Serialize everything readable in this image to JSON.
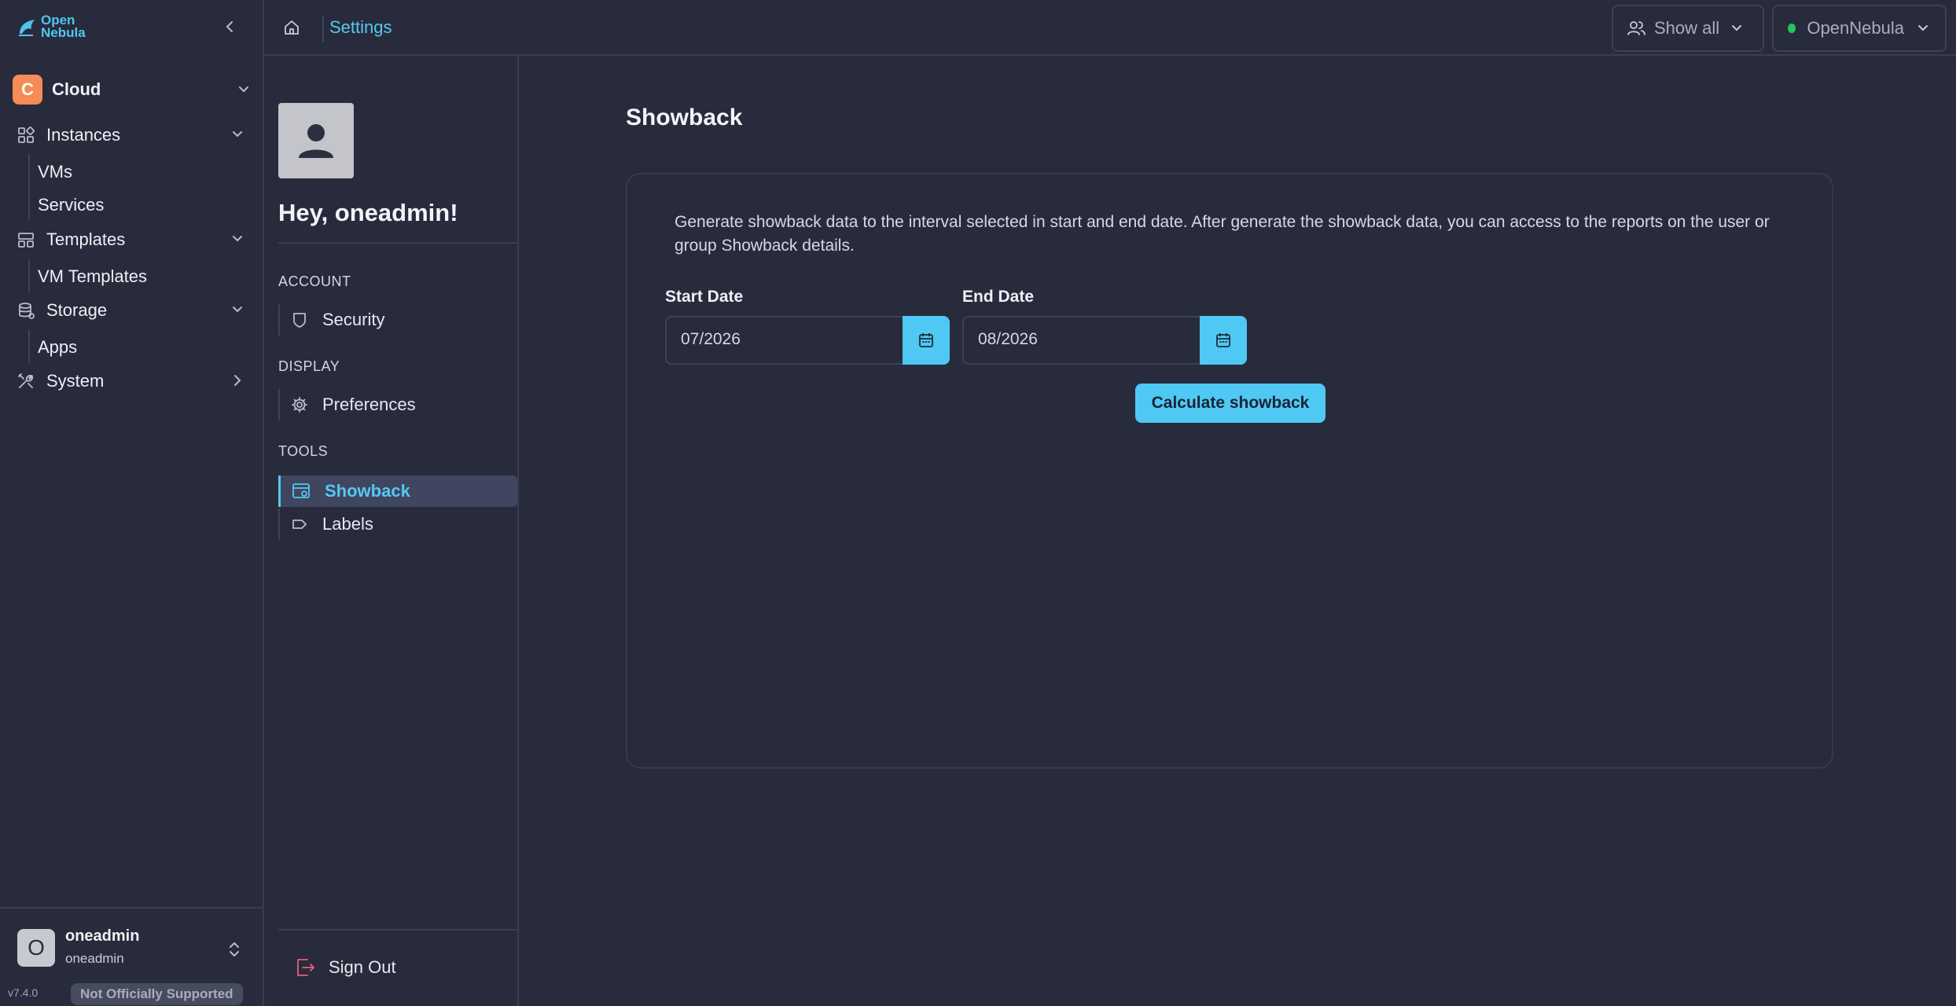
{
  "brand": {
    "logo_line1": "Open",
    "logo_line2": "Nebula"
  },
  "sidebar": {
    "cloud": {
      "initial": "C",
      "label": "Cloud"
    },
    "groups": [
      {
        "label": "Instances",
        "icon": "grid-icon",
        "subitems": [
          "VMs",
          "Services"
        ]
      },
      {
        "label": "Templates",
        "icon": "template-icon",
        "subitems": [
          "VM Templates"
        ]
      },
      {
        "label": "Storage",
        "icon": "database-icon",
        "subitems": [
          "Apps"
        ]
      },
      {
        "label": "System",
        "icon": "tools-icon",
        "subitems": []
      }
    ],
    "user": {
      "initial": "O",
      "name": "oneadmin",
      "group": "oneadmin"
    },
    "version": "v7.4.0",
    "support_badge": "Not Officially Supported"
  },
  "topbar": {
    "breadcrumb": "Settings",
    "group_filter": "Show all",
    "zone": "OpenNebula",
    "zone_status_color": "#22c55e"
  },
  "settings": {
    "greeting": "Hey, oneadmin!",
    "sections": [
      {
        "header": "ACCOUNT",
        "items": [
          {
            "label": "Security",
            "icon": "shield-icon"
          }
        ]
      },
      {
        "header": "DISPLAY",
        "items": [
          {
            "label": "Preferences",
            "icon": "gear-icon"
          }
        ]
      },
      {
        "header": "TOOLS",
        "items": [
          {
            "label": "Showback",
            "icon": "showback-icon",
            "active": true
          },
          {
            "label": "Labels",
            "icon": "tag-icon"
          }
        ]
      }
    ],
    "signout": "Sign Out"
  },
  "main": {
    "title": "Showback",
    "description": "Generate showback data to the interval selected in start and end date. After generate the showback data, you can access to the reports on the user or group Showback details.",
    "start_label": "Start Date",
    "start_value": "07/2026",
    "end_label": "End Date",
    "end_value": "08/2026",
    "button": "Calculate showback"
  },
  "colors": {
    "accent": "#4fc8f3",
    "background": "#282b3b",
    "cloud_avatar": "#f58b55",
    "signout_icon": "#f05a7e"
  }
}
